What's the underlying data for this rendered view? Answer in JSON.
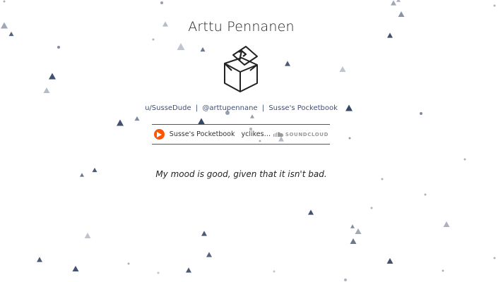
{
  "profile": {
    "name": "Arttu Pennanen",
    "mood": "My mood is good, given that it isn't bad."
  },
  "links": [
    {
      "label": "u/SusseDude"
    },
    {
      "label": "@arttupennane"
    },
    {
      "label": "Susse's Pocketbook"
    }
  ],
  "links_separator": "|",
  "player": {
    "user": "Susse's Pocketbook",
    "title": "yclikesw...",
    "brand": "SOUNDCLOUD",
    "play_icon": "play-icon",
    "brand_icon": "soundcloud-icon"
  },
  "colors": {
    "link": "#3e4f7a",
    "play": "#ff5500",
    "particle": "#2c3e5e"
  }
}
